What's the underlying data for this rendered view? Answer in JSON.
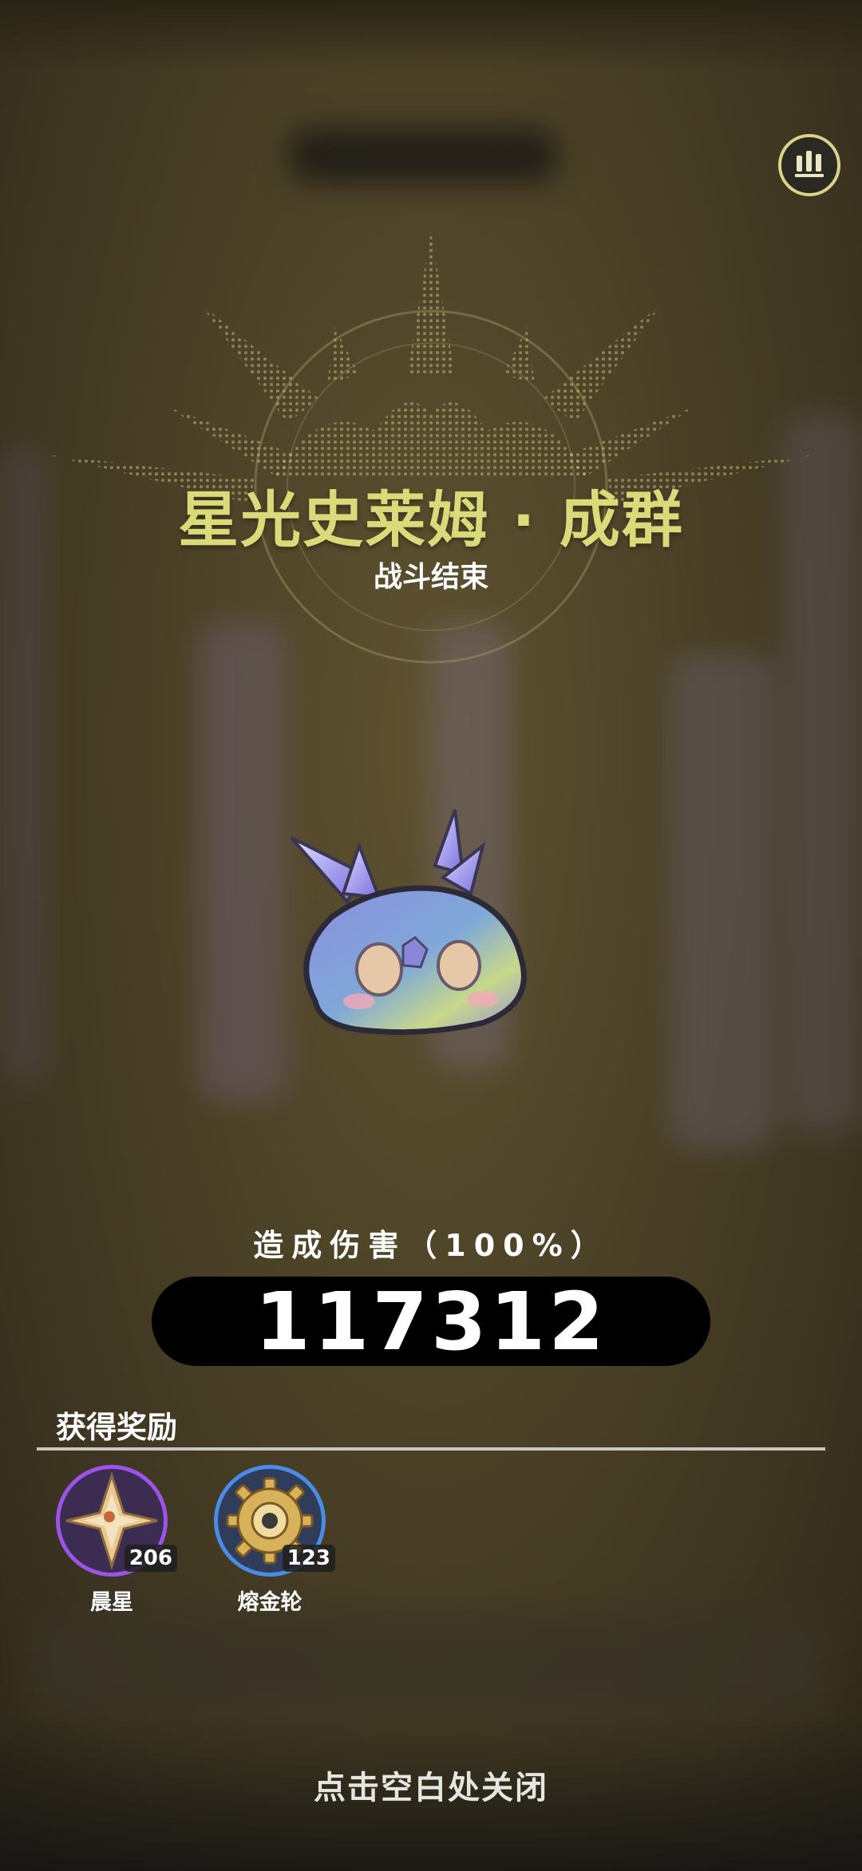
{
  "boss": {
    "name": "星光史莱姆 · 成群",
    "status": "战斗结束"
  },
  "damage": {
    "label": "造成伤害（100%）",
    "value": "117312"
  },
  "rewards": {
    "title": "获得奖励",
    "items": [
      {
        "name": "晨星",
        "count": "206",
        "icon": "morning-star-icon",
        "rarity_color": "#9b54e8"
      },
      {
        "name": "熔金轮",
        "count": "123",
        "icon": "molten-gold-wheel-icon",
        "rarity_color": "#4b8be6"
      }
    ]
  },
  "footer": {
    "close_hint": "点击空白处关闭"
  },
  "icons": {
    "stats": "stats-bars-icon"
  },
  "colors": {
    "title": "#d9db7a",
    "accent_border": "#d9d48a"
  }
}
